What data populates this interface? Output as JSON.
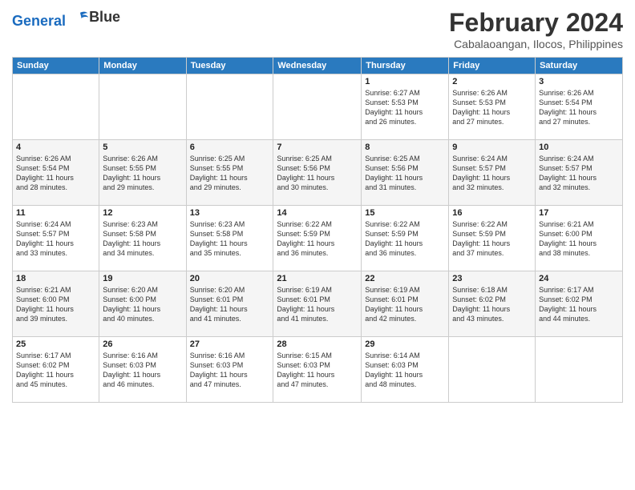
{
  "logo": {
    "line1": "General",
    "line2": "Blue"
  },
  "title": "February 2024",
  "subtitle": "Cabalaoangan, Ilocos, Philippines",
  "headers": [
    "Sunday",
    "Monday",
    "Tuesday",
    "Wednesday",
    "Thursday",
    "Friday",
    "Saturday"
  ],
  "weeks": [
    [
      {
        "num": "",
        "info": ""
      },
      {
        "num": "",
        "info": ""
      },
      {
        "num": "",
        "info": ""
      },
      {
        "num": "",
        "info": ""
      },
      {
        "num": "1",
        "info": "Sunrise: 6:27 AM\nSunset: 5:53 PM\nDaylight: 11 hours\nand 26 minutes."
      },
      {
        "num": "2",
        "info": "Sunrise: 6:26 AM\nSunset: 5:53 PM\nDaylight: 11 hours\nand 27 minutes."
      },
      {
        "num": "3",
        "info": "Sunrise: 6:26 AM\nSunset: 5:54 PM\nDaylight: 11 hours\nand 27 minutes."
      }
    ],
    [
      {
        "num": "4",
        "info": "Sunrise: 6:26 AM\nSunset: 5:54 PM\nDaylight: 11 hours\nand 28 minutes."
      },
      {
        "num": "5",
        "info": "Sunrise: 6:26 AM\nSunset: 5:55 PM\nDaylight: 11 hours\nand 29 minutes."
      },
      {
        "num": "6",
        "info": "Sunrise: 6:25 AM\nSunset: 5:55 PM\nDaylight: 11 hours\nand 29 minutes."
      },
      {
        "num": "7",
        "info": "Sunrise: 6:25 AM\nSunset: 5:56 PM\nDaylight: 11 hours\nand 30 minutes."
      },
      {
        "num": "8",
        "info": "Sunrise: 6:25 AM\nSunset: 5:56 PM\nDaylight: 11 hours\nand 31 minutes."
      },
      {
        "num": "9",
        "info": "Sunrise: 6:24 AM\nSunset: 5:57 PM\nDaylight: 11 hours\nand 32 minutes."
      },
      {
        "num": "10",
        "info": "Sunrise: 6:24 AM\nSunset: 5:57 PM\nDaylight: 11 hours\nand 32 minutes."
      }
    ],
    [
      {
        "num": "11",
        "info": "Sunrise: 6:24 AM\nSunset: 5:57 PM\nDaylight: 11 hours\nand 33 minutes."
      },
      {
        "num": "12",
        "info": "Sunrise: 6:23 AM\nSunset: 5:58 PM\nDaylight: 11 hours\nand 34 minutes."
      },
      {
        "num": "13",
        "info": "Sunrise: 6:23 AM\nSunset: 5:58 PM\nDaylight: 11 hours\nand 35 minutes."
      },
      {
        "num": "14",
        "info": "Sunrise: 6:22 AM\nSunset: 5:59 PM\nDaylight: 11 hours\nand 36 minutes."
      },
      {
        "num": "15",
        "info": "Sunrise: 6:22 AM\nSunset: 5:59 PM\nDaylight: 11 hours\nand 36 minutes."
      },
      {
        "num": "16",
        "info": "Sunrise: 6:22 AM\nSunset: 5:59 PM\nDaylight: 11 hours\nand 37 minutes."
      },
      {
        "num": "17",
        "info": "Sunrise: 6:21 AM\nSunset: 6:00 PM\nDaylight: 11 hours\nand 38 minutes."
      }
    ],
    [
      {
        "num": "18",
        "info": "Sunrise: 6:21 AM\nSunset: 6:00 PM\nDaylight: 11 hours\nand 39 minutes."
      },
      {
        "num": "19",
        "info": "Sunrise: 6:20 AM\nSunset: 6:00 PM\nDaylight: 11 hours\nand 40 minutes."
      },
      {
        "num": "20",
        "info": "Sunrise: 6:20 AM\nSunset: 6:01 PM\nDaylight: 11 hours\nand 41 minutes."
      },
      {
        "num": "21",
        "info": "Sunrise: 6:19 AM\nSunset: 6:01 PM\nDaylight: 11 hours\nand 41 minutes."
      },
      {
        "num": "22",
        "info": "Sunrise: 6:19 AM\nSunset: 6:01 PM\nDaylight: 11 hours\nand 42 minutes."
      },
      {
        "num": "23",
        "info": "Sunrise: 6:18 AM\nSunset: 6:02 PM\nDaylight: 11 hours\nand 43 minutes."
      },
      {
        "num": "24",
        "info": "Sunrise: 6:17 AM\nSunset: 6:02 PM\nDaylight: 11 hours\nand 44 minutes."
      }
    ],
    [
      {
        "num": "25",
        "info": "Sunrise: 6:17 AM\nSunset: 6:02 PM\nDaylight: 11 hours\nand 45 minutes."
      },
      {
        "num": "26",
        "info": "Sunrise: 6:16 AM\nSunset: 6:03 PM\nDaylight: 11 hours\nand 46 minutes."
      },
      {
        "num": "27",
        "info": "Sunrise: 6:16 AM\nSunset: 6:03 PM\nDaylight: 11 hours\nand 47 minutes."
      },
      {
        "num": "28",
        "info": "Sunrise: 6:15 AM\nSunset: 6:03 PM\nDaylight: 11 hours\nand 47 minutes."
      },
      {
        "num": "29",
        "info": "Sunrise: 6:14 AM\nSunset: 6:03 PM\nDaylight: 11 hours\nand 48 minutes."
      },
      {
        "num": "",
        "info": ""
      },
      {
        "num": "",
        "info": ""
      }
    ]
  ]
}
